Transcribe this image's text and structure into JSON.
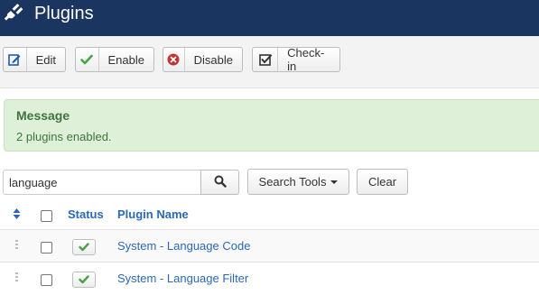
{
  "header": {
    "title": "Plugins",
    "icon": "plug-icon"
  },
  "toolbar": {
    "edit_label": "Edit",
    "enable_label": "Enable",
    "disable_label": "Disable",
    "checkin_label": "Check-in"
  },
  "message": {
    "heading": "Message",
    "body": "2 plugins enabled."
  },
  "filters": {
    "search_value": "language",
    "search_tools_label": "Search Tools",
    "clear_label": "Clear"
  },
  "table": {
    "headers": {
      "status": "Status",
      "plugin_name": "Plugin Name"
    },
    "rows": [
      {
        "name": "System - Language Code",
        "status": "enabled"
      },
      {
        "name": "System - Language Filter",
        "status": "enabled"
      }
    ]
  },
  "colors": {
    "header_bg": "#1b3561",
    "link": "#2a69b8",
    "success_bg": "#dff0d8",
    "success_text": "#3c763d",
    "enabled_check": "#46a546",
    "disable_icon": "#bd362f"
  }
}
